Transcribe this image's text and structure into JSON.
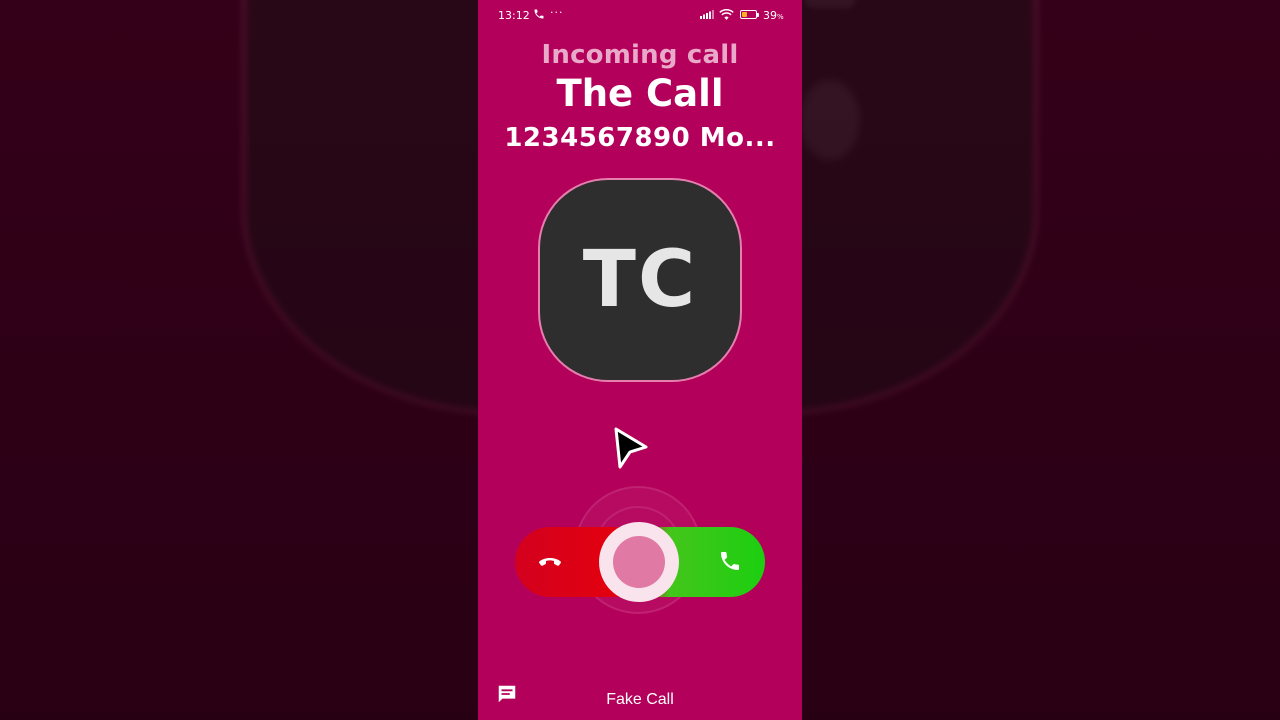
{
  "status_bar": {
    "time": "13:12",
    "more": "···",
    "battery_text": "39",
    "battery_level": 0.39,
    "battery_color": "#ffb020"
  },
  "call": {
    "incoming_label": "Incoming call",
    "caller_name": "The Call",
    "caller_number": "1234567890 Mo...",
    "avatar_initials": "TC"
  },
  "controls": {
    "decline_icon": "phone-hangup-icon",
    "accept_icon": "phone-icon",
    "decline_color": "#e2000f",
    "accept_color": "#1ccf10"
  },
  "footer": {
    "message_icon": "message-icon",
    "app_label": "Fake Call"
  },
  "colors": {
    "screen_background": "#b3005a",
    "avatar_background": "#2e2e2e"
  }
}
